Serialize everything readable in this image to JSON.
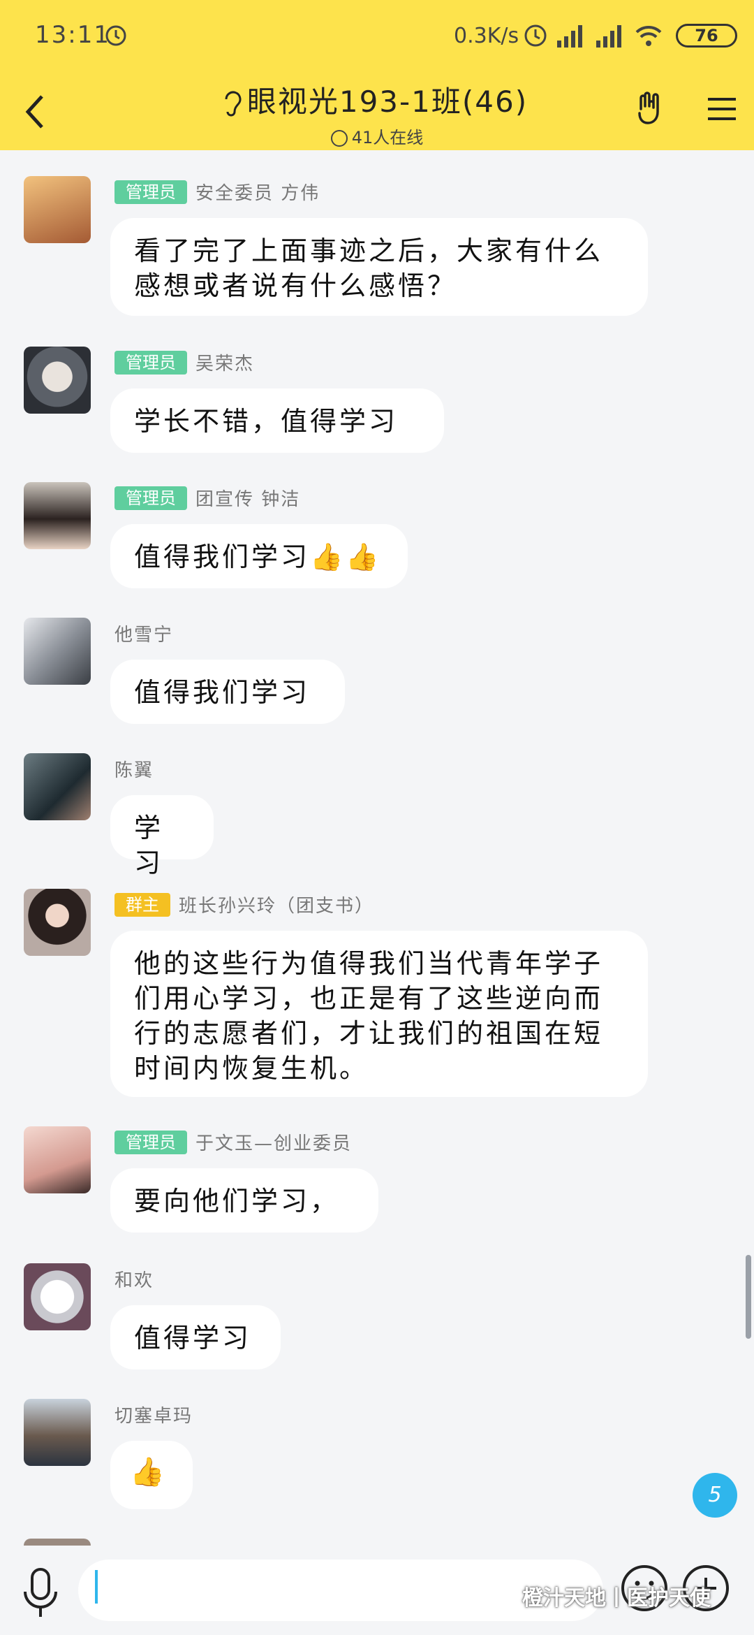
{
  "status": {
    "time": "13:11",
    "net_speed": "0.3K/s",
    "battery": "76"
  },
  "header": {
    "title": "眼视光193-1班(46)",
    "online": "41人在线"
  },
  "messages": [
    {
      "badge": "管理员",
      "badge_type": "admin",
      "name": "安全委员 方伟",
      "text": "看了完了上面事迹之后，大家有什么感想或者说有什么感悟？",
      "avatar_color": "#c98a5a"
    },
    {
      "badge": "管理员",
      "badge_type": "admin",
      "name": "吴荣杰",
      "text": "学长不错，值得学习",
      "avatar_color": "#6c7078"
    },
    {
      "badge": "管理员",
      "badge_type": "admin",
      "name": "团宣传 钟洁",
      "text": "值得我们学习👍👍",
      "avatar_color": "#4a3a34"
    },
    {
      "badge": "",
      "badge_type": "",
      "name": "他雪宁",
      "text": "值得我们学习",
      "avatar_color": "#8a8f96"
    },
    {
      "badge": "",
      "badge_type": "",
      "name": "陈翼",
      "text": "学习",
      "avatar_color": "#3b4a52"
    },
    {
      "badge": "群主",
      "badge_type": "owner",
      "name": "班长孙兴玲（团支书）",
      "text": "他的这些行为值得我们当代青年学子们用心学习，也正是有了这些逆向而行的志愿者们，才让我们的祖国在短时间内恢复生机。",
      "avatar_color": "#5a4840"
    },
    {
      "badge": "管理员",
      "badge_type": "admin",
      "name": "于文玉—创业委员",
      "text": "要向他们学习，",
      "avatar_color": "#d9a8a0"
    },
    {
      "badge": "",
      "badge_type": "",
      "name": "和欢",
      "text": "值得学习",
      "avatar_color": "#c8c8cc"
    },
    {
      "badge": "",
      "badge_type": "",
      "name": "切塞卓玛",
      "text": "👍",
      "avatar_color": "#7a6a5e"
    }
  ],
  "fab_label": "5",
  "input": {
    "placeholder": ""
  },
  "watermark": "橙汁天地丨医护天使",
  "icons": [
    "back-icon",
    "ear-icon",
    "hand-gesture-icon",
    "menu-icon",
    "mic-icon",
    "emoji-icon",
    "plus-icon",
    "alarm-icon",
    "signal-icon",
    "wifi-icon"
  ],
  "colors": {
    "header_bg": "#fde34c",
    "admin_badge": "#5fce9e",
    "owner_badge": "#f4c022",
    "accent": "#2fb6ec"
  }
}
